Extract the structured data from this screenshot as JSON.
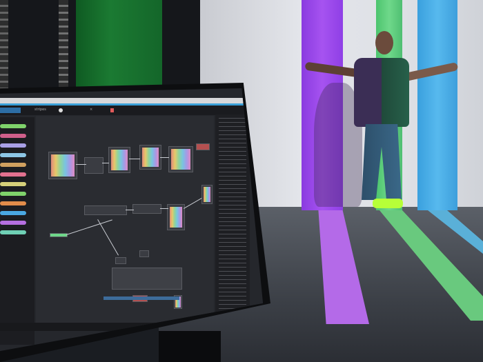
{
  "scene": {
    "description_colors": {
      "purple_beam": "#a653f0",
      "green_beam": "#6fd88a",
      "cyan_beam": "#57b9ee",
      "green_screen": "#1b7a32",
      "accent_blue": "#3aa0d8"
    }
  },
  "app": {
    "tabs": [
      {
        "label": "stripes"
      },
      {
        "label": "×"
      }
    ],
    "left_panel_items": [
      {
        "color": "#7fd36b"
      },
      {
        "color": "#d05f8a"
      },
      {
        "color": "#a9a0e6"
      },
      {
        "color": "#8dc7e6"
      },
      {
        "color": "#d0a05f"
      },
      {
        "color": "#e2718f"
      },
      {
        "color": "#d6d07a"
      },
      {
        "color": "#7fd36b"
      },
      {
        "color": "#e28c4a"
      },
      {
        "color": "#4aa8e2"
      },
      {
        "color": "#b56fe0"
      },
      {
        "color": "#6fd0b5"
      }
    ],
    "icons": [
      "search-icon",
      "close-icon",
      "node-icon"
    ]
  }
}
